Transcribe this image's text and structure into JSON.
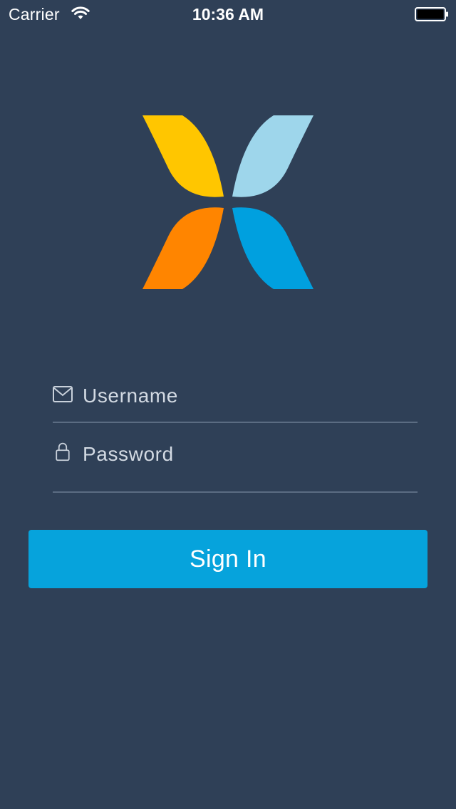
{
  "status_bar": {
    "carrier": "Carrier",
    "time": "10:36 AM",
    "wifi_icon": "wifi-icon",
    "battery_icon": "battery-icon"
  },
  "logo": {
    "icon": "app-logo-icon",
    "colors": {
      "top_left": "#ffc600",
      "top_right": "#9ed6eb",
      "bottom_left": "#ff8500",
      "bottom_right": "#00a0df"
    }
  },
  "form": {
    "username": {
      "placeholder": "Username",
      "value": "",
      "icon": "envelope-icon"
    },
    "password": {
      "placeholder": "Password",
      "value": "",
      "icon": "lock-icon"
    }
  },
  "sign_in": {
    "label": "Sign In",
    "color": "#06a3dc"
  },
  "theme": {
    "background": "#2f4057",
    "divider": "#5b6c82"
  }
}
